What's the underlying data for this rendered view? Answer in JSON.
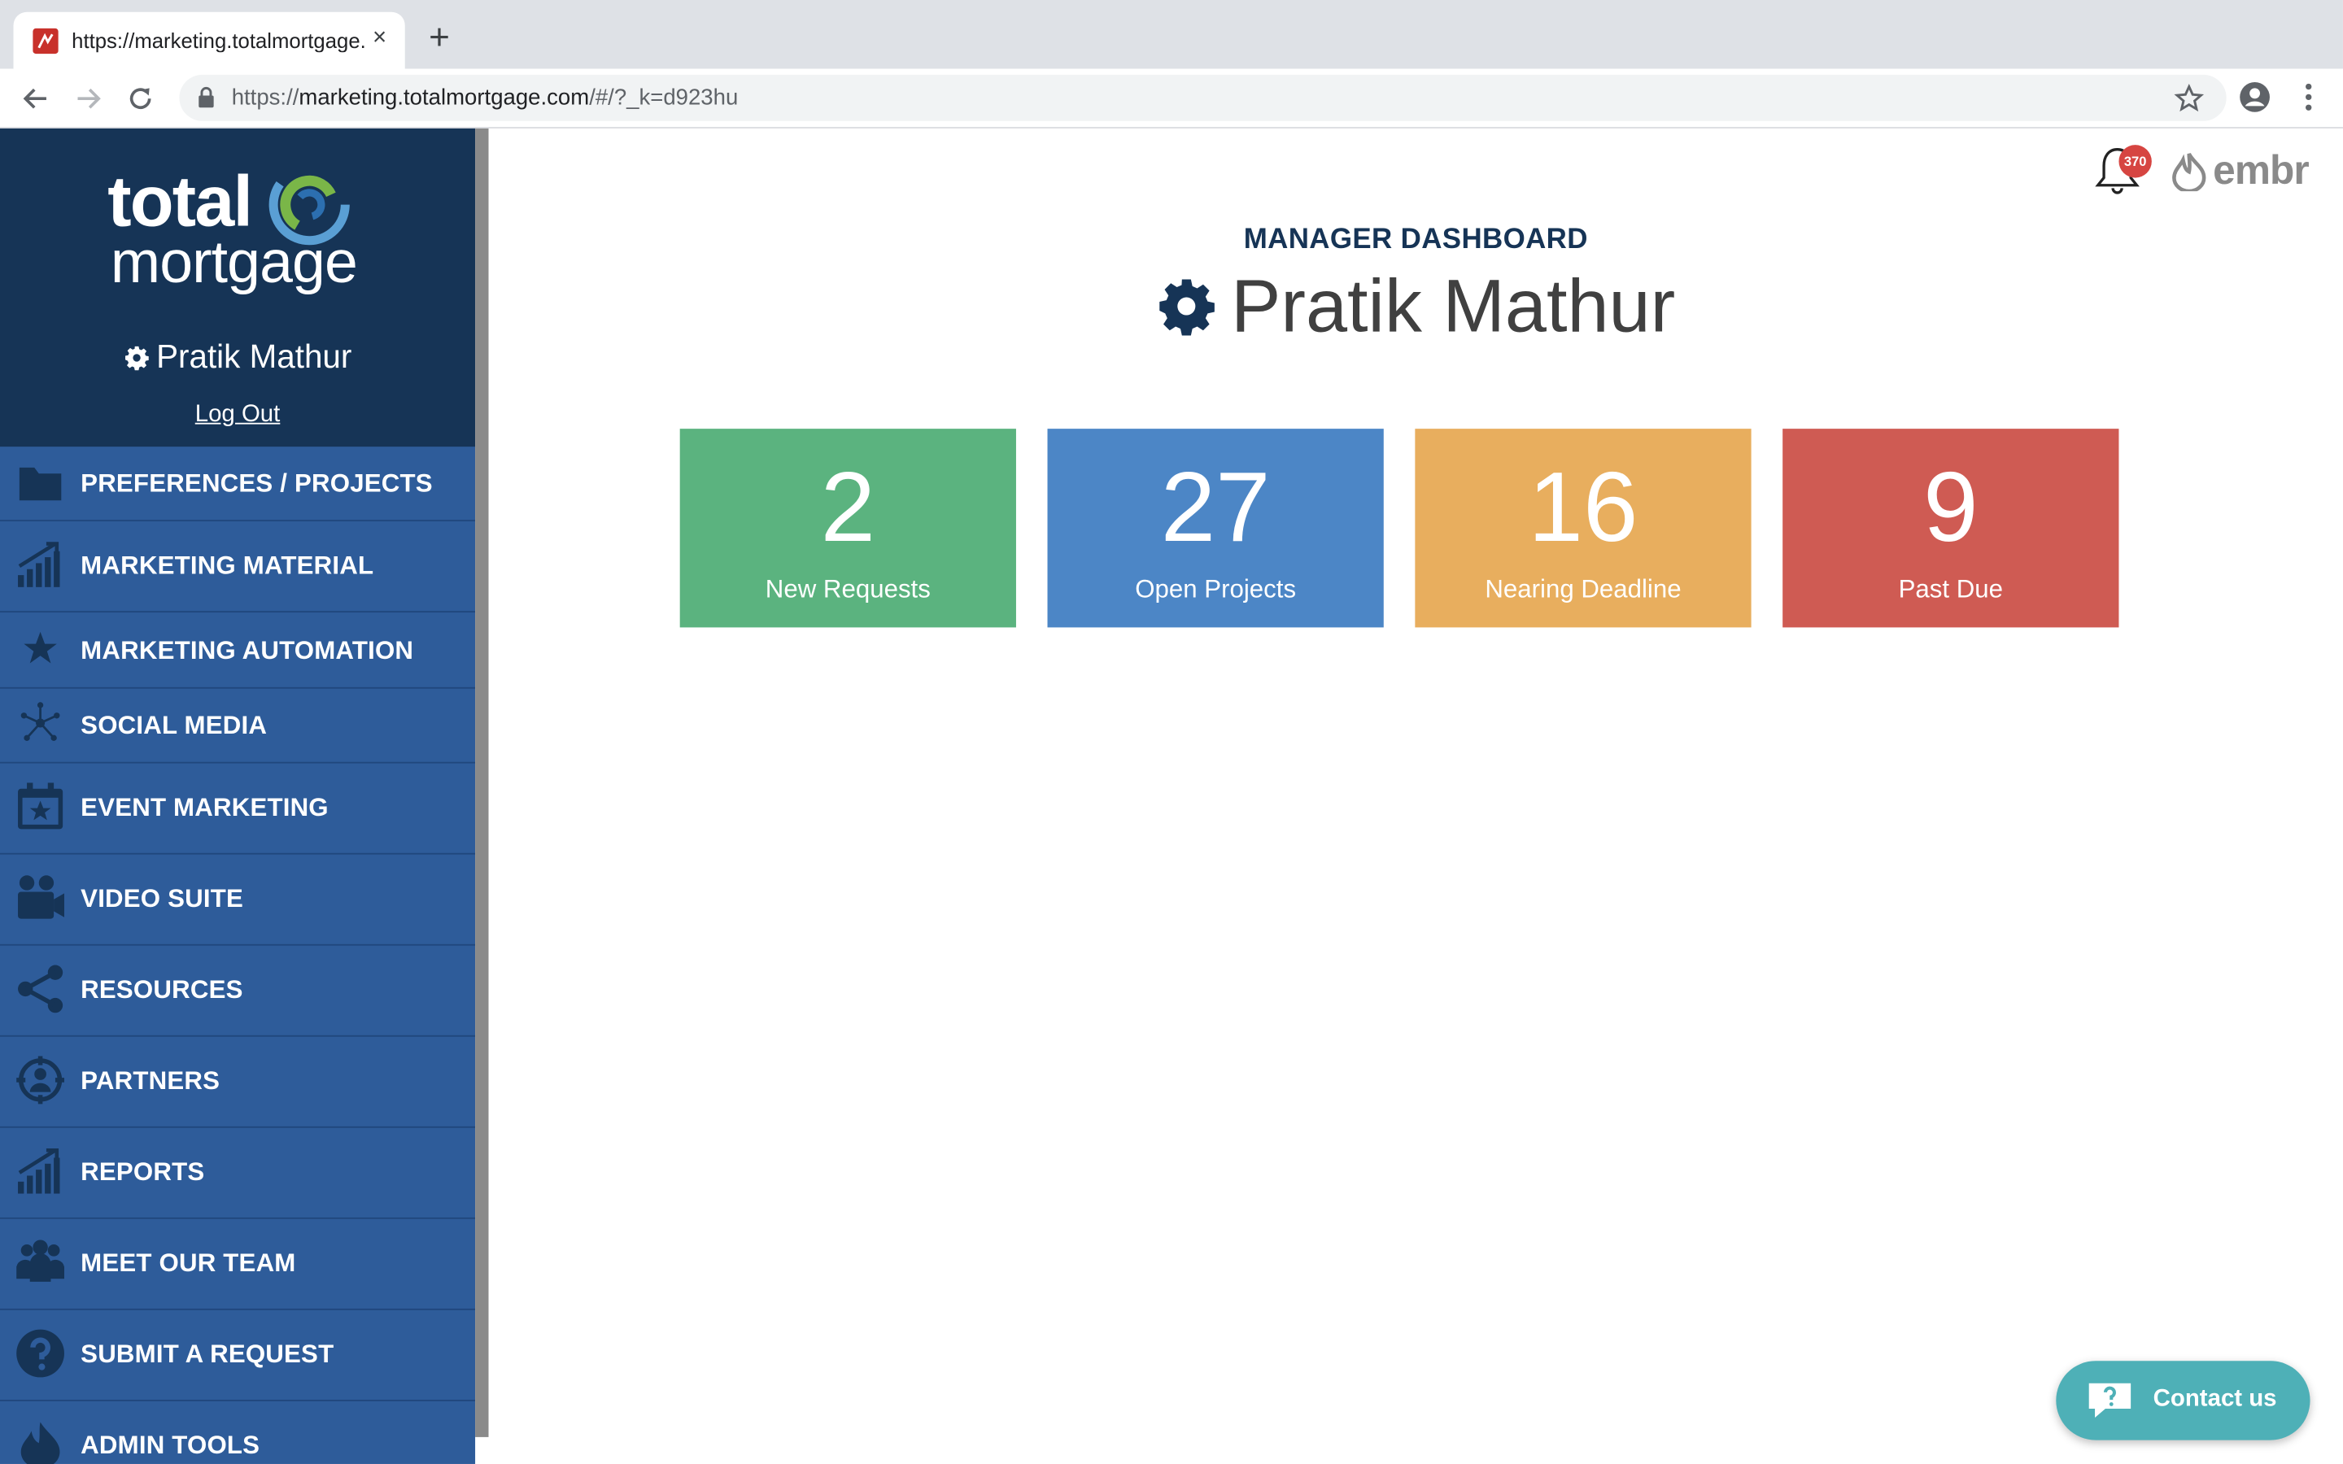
{
  "browser": {
    "tab_title": "https://marketing.totalmortgage.com",
    "new_tab_symbol": "+",
    "close_symbol": "×",
    "url_prefix": "https://",
    "url_host": "marketing.totalmortgage.com",
    "url_path": "/#/?_k=d923hu"
  },
  "sidebar": {
    "logo_line1": "total",
    "logo_line2": "mortgage",
    "user_name": "Pratik Mathur",
    "logout_label": "Log Out",
    "items": [
      {
        "label": "PREFERENCES / PROJECTS",
        "icon": "folder-icon"
      },
      {
        "label": "MARKETING MATERIAL",
        "icon": "growth-chart-icon"
      },
      {
        "label": "MARKETING AUTOMATION",
        "icon": "star-icon"
      },
      {
        "label": "SOCIAL MEDIA",
        "icon": "network-icon"
      },
      {
        "label": "EVENT MARKETING",
        "icon": "calendar-star-icon"
      },
      {
        "label": "VIDEO SUITE",
        "icon": "video-camera-icon"
      },
      {
        "label": "RESOURCES",
        "icon": "share-icon"
      },
      {
        "label": "PARTNERS",
        "icon": "target-person-icon"
      },
      {
        "label": "REPORTS",
        "icon": "growth-chart-icon"
      },
      {
        "label": "MEET OUR TEAM",
        "icon": "team-icon"
      },
      {
        "label": "SUBMIT A REQUEST",
        "icon": "question-circle-icon"
      },
      {
        "label": "ADMIN TOOLS",
        "icon": "flame-icon"
      }
    ]
  },
  "header": {
    "notification_count": "370",
    "brand": "embr"
  },
  "dashboard": {
    "label": "MANAGER DASHBOARD",
    "name": "Pratik Mathur",
    "stats": [
      {
        "value": "2",
        "label": "New Requests",
        "color": "#5bb37f"
      },
      {
        "value": "27",
        "label": "Open Projects",
        "color": "#4c86c6"
      },
      {
        "value": "16",
        "label": "Nearing Deadline",
        "color": "#e8ae5e"
      },
      {
        "value": "9",
        "label": "Past Due",
        "color": "#cf5b53"
      }
    ]
  },
  "contact": {
    "label": "Contact us"
  },
  "colors": {
    "sidebar_dark": "#163456",
    "sidebar_nav": "#2e5c9a",
    "accent_teal": "#4eb0b7"
  }
}
